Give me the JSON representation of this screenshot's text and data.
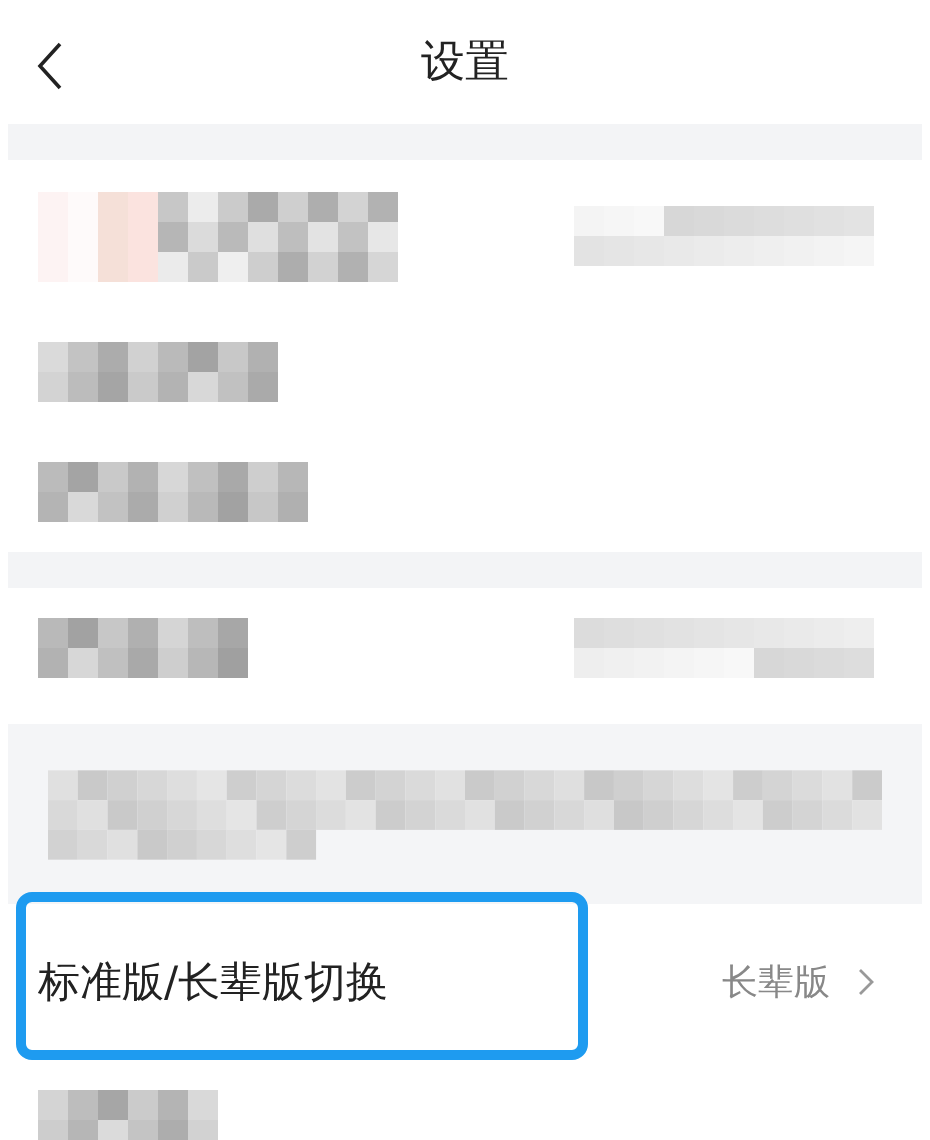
{
  "header": {
    "title": "设置"
  },
  "sections": [
    {
      "kind": "band"
    },
    {
      "kind": "blurred-profile",
      "value_blurred": true
    },
    {
      "kind": "blurred-row",
      "value_blurred": false
    },
    {
      "kind": "blurred-row",
      "value_blurred": false
    },
    {
      "kind": "band"
    },
    {
      "kind": "blurred-row",
      "value_blurred": true
    },
    {
      "kind": "blurred-note"
    },
    {
      "kind": "setting",
      "label": "标准版/长辈版切换",
      "value": "长辈版",
      "highlighted": true
    },
    {
      "kind": "blurred-row",
      "value_blurred": false
    }
  ]
}
